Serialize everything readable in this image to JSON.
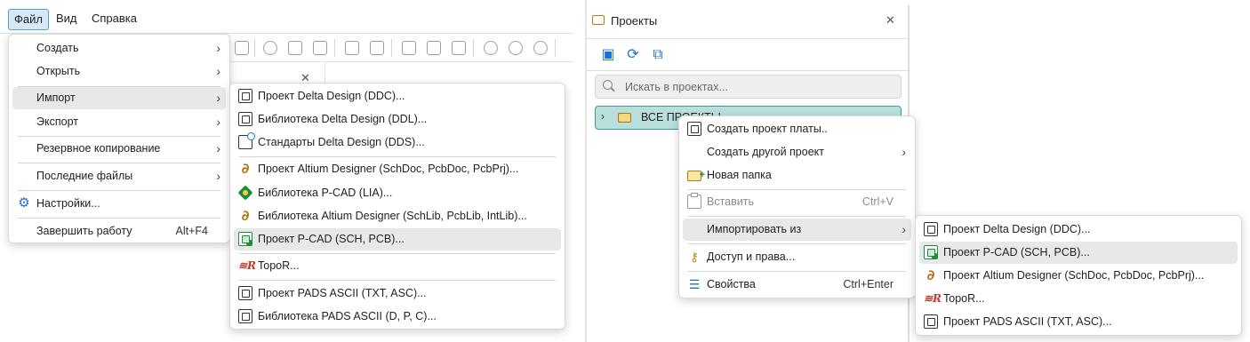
{
  "menubar": {
    "items": [
      "Файл",
      "Вид",
      "Справка"
    ]
  },
  "file_menu": {
    "items": [
      {
        "label": "Создать",
        "submenu": true
      },
      {
        "label": "Открыть",
        "submenu": true
      },
      {
        "label": "Импорт",
        "submenu": true,
        "highlighted": true
      },
      {
        "label": "Экспорт",
        "submenu": true
      },
      {
        "label": "Резервное копирование",
        "submenu": true
      },
      {
        "label": "Последние файлы",
        "submenu": true
      },
      {
        "label": "Настройки...",
        "icon": "gear-icon"
      },
      {
        "label": "Завершить работу",
        "shortcut": "Alt+F4"
      }
    ]
  },
  "import_submenu": {
    "items": [
      {
        "label": "Проект Delta Design (DDC)...",
        "icon": "delta-project-icon"
      },
      {
        "label": "Библиотека Delta Design (DDL)...",
        "icon": "delta-library-icon"
      },
      {
        "label": "Стандарты Delta Design (DDS)...",
        "icon": "delta-standards-icon"
      },
      {
        "label": "Проект Altium Designer (SchDoc, PcbDoc, PcbPrj)...",
        "icon": "altium-icon"
      },
      {
        "label": "Библиотека P-CAD (LIA)...",
        "icon": "pcad-library-icon"
      },
      {
        "label": "Библиотека Altium Designer (SchLib, PcbLib, IntLib)...",
        "icon": "altium-icon"
      },
      {
        "label": "Проект P-CAD (SCH, PCB)...",
        "icon": "pcad-project-icon",
        "highlighted": true
      },
      {
        "label": "TopoR...",
        "icon": "topor-icon"
      },
      {
        "label": "Проект PADS ASCII (TXT, ASC)...",
        "icon": "pads-project-icon"
      },
      {
        "label": "Библиотека PADS ASCII (D, P, C)...",
        "icon": "pads-library-icon"
      }
    ]
  },
  "projects_panel": {
    "title": "Проекты",
    "search_placeholder": "Искать в проектах...",
    "tree_root": "ВСЕ ПРОЕКТЫ"
  },
  "context_menu": {
    "items": [
      {
        "label": "Создать проект платы..",
        "icon": "board-project-icon"
      },
      {
        "label": "Создать другой проект",
        "submenu": true
      },
      {
        "label": "Новая папка",
        "icon": "new-folder-icon"
      },
      {
        "label": "Вставить",
        "shortcut": "Ctrl+V",
        "disabled": true,
        "icon": "paste-icon"
      },
      {
        "label": "Импортировать из",
        "submenu": true,
        "highlighted": true
      },
      {
        "label": "Доступ и права...",
        "icon": "key-icon"
      },
      {
        "label": "Свойства",
        "shortcut": "Ctrl+Enter",
        "icon": "properties-icon"
      }
    ]
  },
  "import_from_submenu": {
    "items": [
      {
        "label": "Проект Delta Design (DDC)...",
        "icon": "delta-project-icon"
      },
      {
        "label": "Проект P-CAD (SCH, PCB)...",
        "icon": "pcad-project-icon",
        "highlighted": true
      },
      {
        "label": "Проект Altium Designer (SchDoc, PcbDoc, PcbPrj)...",
        "icon": "altium-icon"
      },
      {
        "label": "TopoR...",
        "icon": "topor-icon"
      },
      {
        "label": "Проект PADS ASCII (TXT, ASC)...",
        "icon": "pads-project-icon"
      }
    ]
  },
  "colors": {
    "accent": "#1f6fd1",
    "tree_selected_bg": "#b8dfdb",
    "tree_selected_border": "#3f9a93",
    "menu_highlight": "#e8e8e8"
  }
}
